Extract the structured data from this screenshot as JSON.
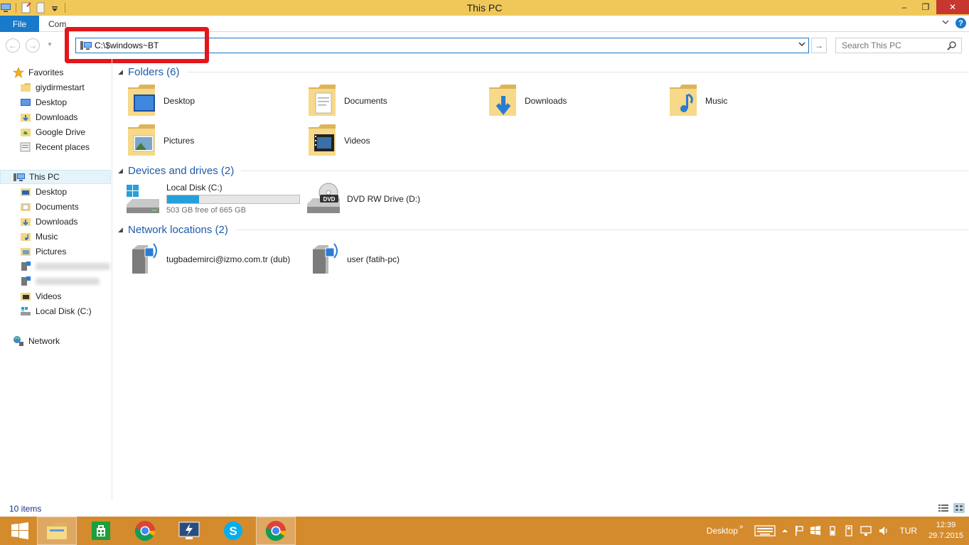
{
  "window": {
    "title": "This PC",
    "controls": {
      "minimize": "–",
      "maximize": "❐",
      "close": "✕"
    }
  },
  "ribbon": {
    "file_tab": "File",
    "computer_tab": "Com",
    "expand_icon": "chevron-down-icon",
    "help": "?"
  },
  "address": {
    "path": "C:\\$windows~BT",
    "search_placeholder": "Search This PC",
    "back": "←",
    "forward": "→",
    "go": "→"
  },
  "sidebar": {
    "favorites_label": "Favorites",
    "favorites": [
      "giydirmestart",
      "Desktop",
      "Downloads",
      "Google Drive",
      "Recent places"
    ],
    "thispc_label": "This PC",
    "thispc_items": [
      "Desktop",
      "Documents",
      "Downloads",
      "Music",
      "Pictures",
      "Videos",
      "Local Disk (C:)"
    ],
    "network_label": "Network"
  },
  "content": {
    "folders_header": "Folders (6)",
    "folders": [
      "Desktop",
      "Documents",
      "Downloads",
      "Music",
      "Pictures",
      "Videos"
    ],
    "devices_header": "Devices and drives (2)",
    "local_disk": {
      "name": "Local Disk (C:)",
      "free_text": "503 GB free of 665 GB",
      "used_fraction": 0.244
    },
    "dvd": {
      "name": "DVD RW Drive (D:)",
      "badge": "DVD"
    },
    "network_header": "Network locations (2)",
    "network": [
      "tugbademirci@izmo.com.tr (dub)",
      "user (fatih-pc)"
    ]
  },
  "status": {
    "count": "10 items"
  },
  "taskbar": {
    "desktop_label": "Desktop",
    "chevron": "»",
    "language": "TUR",
    "time": "12:39",
    "date": "29.7.2015"
  },
  "colors": {
    "accent": "#1979ca",
    "title_bar": "#f0c85a",
    "taskbar": "#d48b2e",
    "highlight": "#e3161b",
    "disk_fill": "#26a0da"
  }
}
